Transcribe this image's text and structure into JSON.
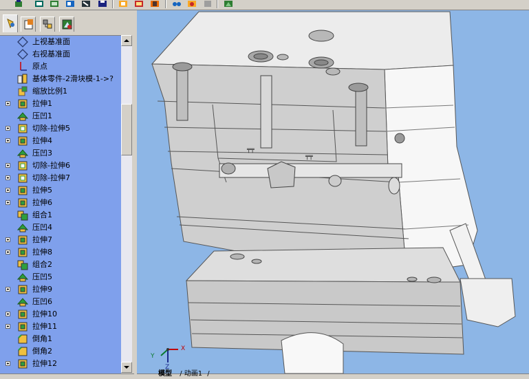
{
  "tree": {
    "items": [
      {
        "label": "上视基准面",
        "icon": "plane-icon",
        "expandable": false
      },
      {
        "label": "右视基准面",
        "icon": "plane-icon",
        "expandable": false
      },
      {
        "label": "原点",
        "icon": "origin-icon",
        "expandable": false
      },
      {
        "label": "基体零件-2滑块模-1->?",
        "icon": "base-part-icon",
        "expandable": false
      },
      {
        "label": "缩放比例1",
        "icon": "scale-icon",
        "expandable": false
      },
      {
        "label": "拉伸1",
        "icon": "extrude-icon",
        "expandable": true
      },
      {
        "label": "压凹1",
        "icon": "indent-icon",
        "expandable": false
      },
      {
        "label": "切除-拉伸5",
        "icon": "cut-extrude-icon",
        "expandable": true
      },
      {
        "label": "拉伸4",
        "icon": "extrude-icon",
        "expandable": true
      },
      {
        "label": "压凹3",
        "icon": "indent-icon",
        "expandable": false
      },
      {
        "label": "切除-拉伸6",
        "icon": "cut-extrude-icon",
        "expandable": true
      },
      {
        "label": "切除-拉伸7",
        "icon": "cut-extrude-icon",
        "expandable": true
      },
      {
        "label": "拉伸5",
        "icon": "extrude-icon",
        "expandable": true
      },
      {
        "label": "拉伸6",
        "icon": "extrude-icon",
        "expandable": true
      },
      {
        "label": "组合1",
        "icon": "combine-icon",
        "expandable": false
      },
      {
        "label": "压凹4",
        "icon": "indent-icon",
        "expandable": false
      },
      {
        "label": "拉伸7",
        "icon": "extrude-icon",
        "expandable": true
      },
      {
        "label": "拉伸8",
        "icon": "extrude-icon",
        "expandable": true
      },
      {
        "label": "组合2",
        "icon": "combine-icon",
        "expandable": false
      },
      {
        "label": "压凹5",
        "icon": "indent-icon",
        "expandable": false
      },
      {
        "label": "拉伸9",
        "icon": "extrude-icon",
        "expandable": true
      },
      {
        "label": "压凹6",
        "icon": "indent-icon",
        "expandable": false
      },
      {
        "label": "拉伸10",
        "icon": "extrude-icon",
        "expandable": true
      },
      {
        "label": "拉伸11",
        "icon": "extrude-icon",
        "expandable": true
      },
      {
        "label": "倒角1",
        "icon": "chamfer-icon",
        "expandable": false
      },
      {
        "label": "倒角2",
        "icon": "chamfer-icon",
        "expandable": false
      },
      {
        "label": "拉伸12",
        "icon": "extrude-icon",
        "expandable": true
      }
    ]
  },
  "bottom_tabs": {
    "model": "模型",
    "animation": "动画1"
  },
  "triad": {
    "x": "X",
    "y": "Y",
    "z": "Z"
  },
  "colors": {
    "tree_bg": "#7fa0ec",
    "viewport_bg": "#8db6e6",
    "chrome": "#d4d0c8"
  }
}
